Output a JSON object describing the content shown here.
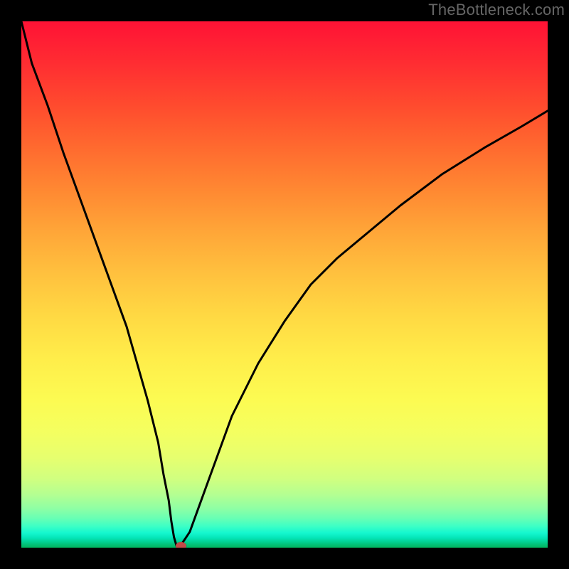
{
  "watermark": "TheBottleneck.com",
  "chart_data": {
    "type": "line",
    "title": "",
    "xlabel": "",
    "ylabel": "",
    "x_range": [
      0,
      100
    ],
    "y_range": [
      0,
      100
    ],
    "grid": false,
    "legend": false,
    "series": [
      {
        "name": "curve",
        "x": [
          0,
          2,
          5,
          8,
          12,
          16,
          20,
          24,
          26,
          27,
          28,
          28.5,
          29,
          29.5,
          30,
          32,
          36,
          40,
          45,
          50,
          55,
          60,
          66,
          72,
          80,
          88,
          95,
          100
        ],
        "y": [
          100,
          92,
          84,
          75,
          64,
          53,
          42,
          28,
          20,
          14,
          9,
          5,
          2,
          0.3,
          0,
          3,
          14,
          25,
          35,
          43,
          50,
          55,
          60,
          65,
          71,
          76,
          80,
          83
        ]
      }
    ],
    "marker": {
      "name": "optimum",
      "x": 30.3,
      "y": 0.4,
      "color": "#c24a48"
    },
    "background": "rainbow-vertical",
    "colors": {
      "top": "#ff1235",
      "bottom": "#02b560",
      "curve": "#000000",
      "frame": "#000000"
    }
  }
}
